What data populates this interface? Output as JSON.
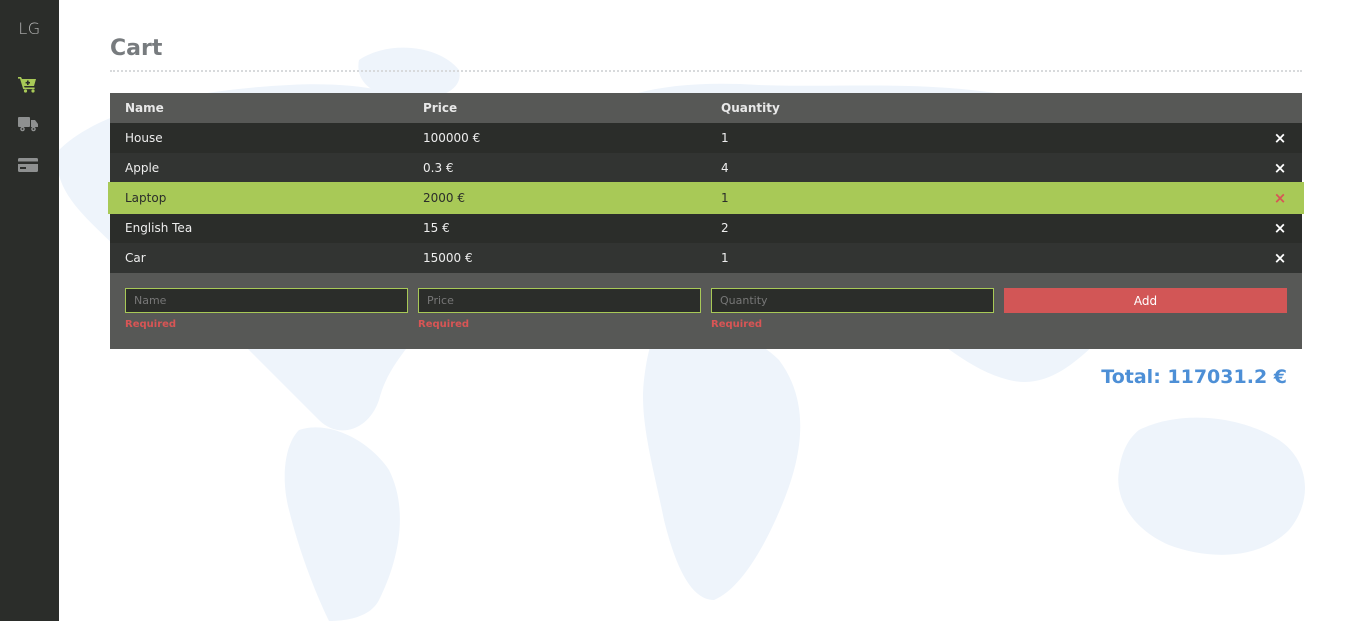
{
  "sidebar": {
    "logo": "LG",
    "items": [
      {
        "icon": "cart-icon",
        "active": true
      },
      {
        "icon": "truck-icon",
        "active": false
      },
      {
        "icon": "credit-card-icon",
        "active": false
      }
    ]
  },
  "page": {
    "title": "Cart"
  },
  "table": {
    "headers": {
      "name": "Name",
      "price": "Price",
      "quantity": "Quantity"
    },
    "rows": [
      {
        "name": "House",
        "price": "100000 €",
        "quantity": "1"
      },
      {
        "name": "Apple",
        "price": "0.3 €",
        "quantity": "4"
      },
      {
        "name": "Laptop",
        "price": "2000 €",
        "quantity": "1"
      },
      {
        "name": "English Tea",
        "price": "15 €",
        "quantity": "2"
      },
      {
        "name": "Car",
        "price": "15000 €",
        "quantity": "1"
      }
    ],
    "delete_glyph": "×"
  },
  "form": {
    "name_placeholder": "Name",
    "price_placeholder": "Price",
    "quantity_placeholder": "Quantity",
    "required_label": "Required",
    "add_label": "Add"
  },
  "total": {
    "label": "Total: 117031.2 €"
  },
  "colors": {
    "sidebar_bg": "#2b2d2a",
    "accent_green": "#a8c957",
    "danger_red": "#d25656",
    "total_blue": "#4d8fd6"
  }
}
